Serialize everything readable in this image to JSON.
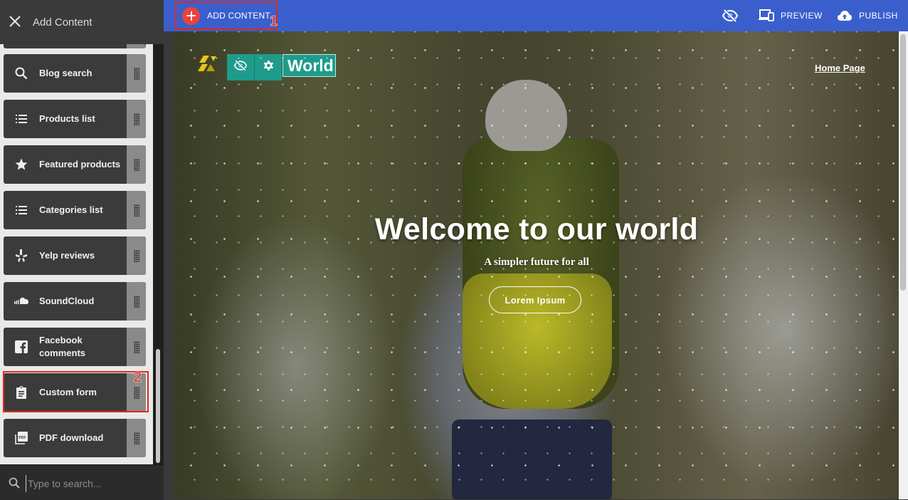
{
  "sidebar": {
    "title": "Add Content",
    "items": [
      {
        "label": "Blog search",
        "icon": "search-icon"
      },
      {
        "label": "Products list",
        "icon": "list-icon"
      },
      {
        "label": "Featured products",
        "icon": "star-icon"
      },
      {
        "label": "Categories list",
        "icon": "list-icon"
      },
      {
        "label": "Yelp reviews",
        "icon": "yelp-icon"
      },
      {
        "label": "SoundCloud",
        "icon": "soundcloud-icon"
      },
      {
        "label": "Facebook comments",
        "icon": "facebook-icon"
      },
      {
        "label": "Custom form",
        "icon": "clipboard-icon"
      },
      {
        "label": "PDF download",
        "icon": "pdf-icon"
      }
    ],
    "search_placeholder": "Type to search..."
  },
  "topbar": {
    "add_content_label": "ADD CONTENT",
    "preview_label": "PREVIEW",
    "publish_label": "PUBLISH"
  },
  "annotations": {
    "marker_1": "1",
    "marker_2": "2",
    "color": "#e0281e"
  },
  "site": {
    "logo_text": "World",
    "nav_home": "Home Page",
    "hero_title": "Welcome to our world",
    "hero_subtitle": "A simpler future for all",
    "hero_button": "Lorem Ipsum"
  },
  "colors": {
    "topbar": "#3a5fcd",
    "add_button": "#e8433a",
    "logo_toolbar": "#1f9b8c",
    "sidebar_item": "#3b3b3b"
  }
}
